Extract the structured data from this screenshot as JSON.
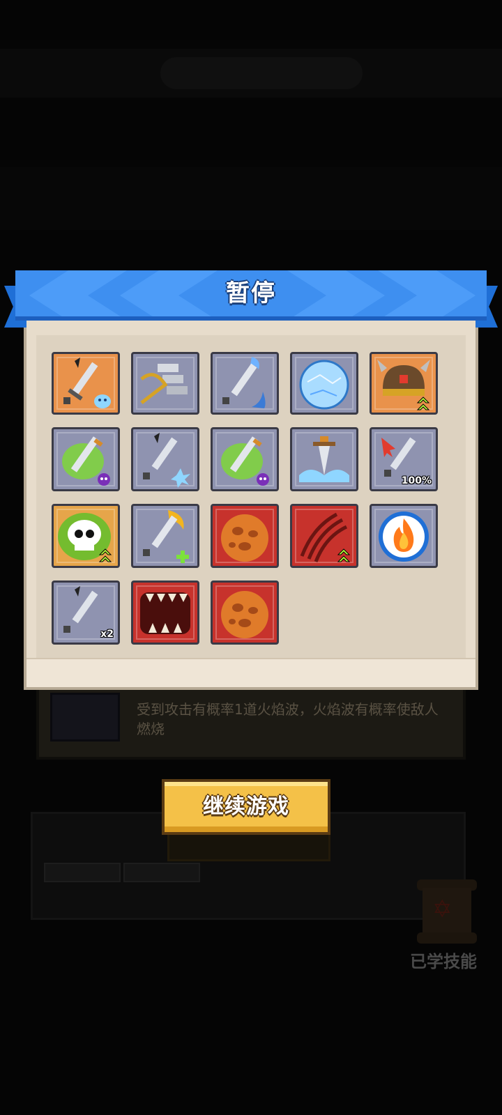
{
  "dialog": {
    "title": "暂停"
  },
  "background": {
    "description": "受到攻击有概率1道火焰波，火焰波有概率使敌人燃烧",
    "learned_skills_label": "已学技能"
  },
  "skills": [
    {
      "icon": "sword-slime-icon",
      "badge": ""
    },
    {
      "icon": "gold-sword-stack-icon",
      "badge": ""
    },
    {
      "icon": "sword-wave-icon",
      "badge": ""
    },
    {
      "icon": "ice-orb-icon",
      "badge": ""
    },
    {
      "icon": "viking-helmet-upgrade-icon",
      "badge": ""
    },
    {
      "icon": "poison-dagger-icon",
      "badge": ""
    },
    {
      "icon": "sword-ice-burst-icon",
      "badge": ""
    },
    {
      "icon": "poison-dagger-icon",
      "badge": ""
    },
    {
      "icon": "sword-ground-splash-icon",
      "badge": ""
    },
    {
      "icon": "sword-crit-icon",
      "badge": "100%"
    },
    {
      "icon": "skull-poison-upgrade-icon",
      "badge": ""
    },
    {
      "icon": "sword-heal-icon",
      "badge": ""
    },
    {
      "icon": "fire-egg-icon",
      "badge": ""
    },
    {
      "icon": "claw-slash-upgrade-icon",
      "badge": ""
    },
    {
      "icon": "fire-shield-orb-icon",
      "badge": ""
    },
    {
      "icon": "sword-double-icon",
      "badge": "x2"
    },
    {
      "icon": "monster-mouth-icon",
      "badge": ""
    },
    {
      "icon": "fire-egg-icon",
      "badge": ""
    }
  ],
  "buttons": {
    "continue_label": "继续游戏"
  },
  "colors": {
    "banner": "#3e8ff0",
    "panel": "#e7dccb",
    "button": "#f4c148"
  }
}
